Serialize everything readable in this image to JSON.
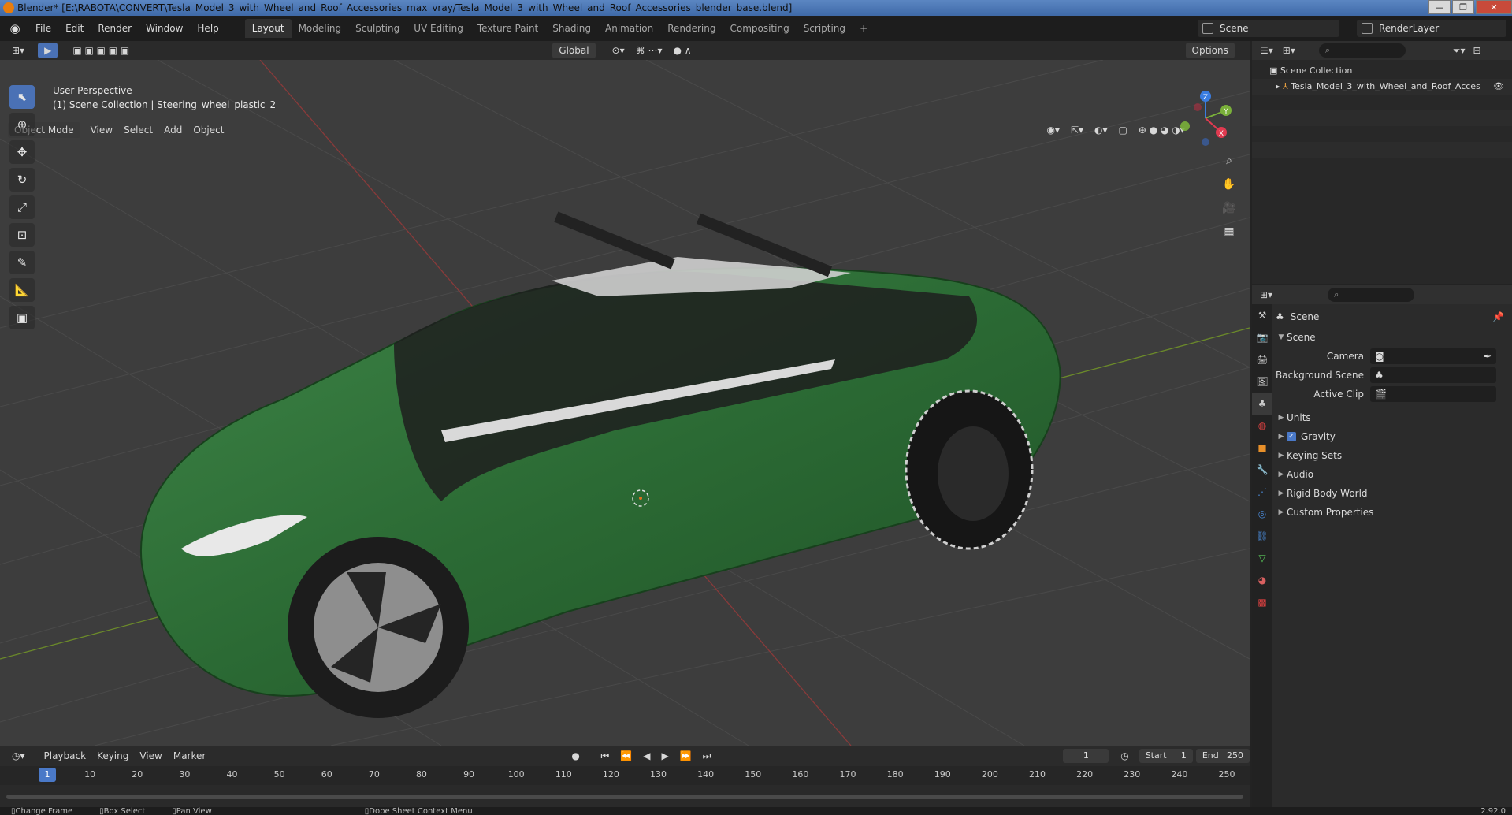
{
  "window": {
    "title": "Blender* [E:\\RABOTA\\CONVERT\\Tesla_Model_3_with_Wheel_and_Roof_Accessories_max_vray/Tesla_Model_3_with_Wheel_and_Roof_Accessories_blender_base.blend]",
    "min": "—",
    "restore": "❐",
    "close": "✕"
  },
  "menu": [
    "File",
    "Edit",
    "Render",
    "Window",
    "Help"
  ],
  "workspaces": [
    "Layout",
    "Modeling",
    "Sculpting",
    "UV Editing",
    "Texture Paint",
    "Shading",
    "Animation",
    "Rendering",
    "Compositing",
    "Scripting"
  ],
  "workspace_add": "+",
  "scene": {
    "label": "Scene"
  },
  "renderlayer": {
    "label": "RenderLayer"
  },
  "viewport": {
    "transform": "Global",
    "options": "Options",
    "mode": "Object Mode",
    "menus": [
      "View",
      "Select",
      "Add",
      "Object"
    ],
    "overlay_line1": "User Perspective",
    "overlay_line2": "(1) Scene Collection | Steering_wheel_plastic_2",
    "gizmo": {
      "z": "Z",
      "y": "Y",
      "x": "X"
    }
  },
  "outliner": {
    "collection": "Scene Collection",
    "object": "Tesla_Model_3_with_Wheel_and_Roof_Acces"
  },
  "properties": {
    "header": "Scene",
    "panel": "Scene",
    "camera_label": "Camera",
    "background_label": "Background Scene",
    "clip_label": "Active Clip",
    "sections": [
      "Units",
      "Gravity",
      "Keying Sets",
      "Audio",
      "Rigid Body World",
      "Custom Properties"
    ]
  },
  "timeline": {
    "menus": [
      "Playback",
      "Keying",
      "View",
      "Marker"
    ],
    "current_frame": "1",
    "start_label": "Start",
    "start": "1",
    "end_label": "End",
    "end": "250",
    "ticks": [
      "1",
      "10",
      "20",
      "30",
      "40",
      "50",
      "60",
      "70",
      "80",
      "90",
      "100",
      "110",
      "120",
      "130",
      "140",
      "150",
      "160",
      "170",
      "180",
      "190",
      "200",
      "210",
      "220",
      "230",
      "240",
      "250"
    ]
  },
  "status": {
    "items": [
      "Change Frame",
      "Box Select",
      "Pan View",
      "Dope Sheet Context Menu"
    ],
    "version": "2.92.0"
  },
  "colors": {
    "accent": "#4a79c8",
    "car": "#2d6b36"
  }
}
